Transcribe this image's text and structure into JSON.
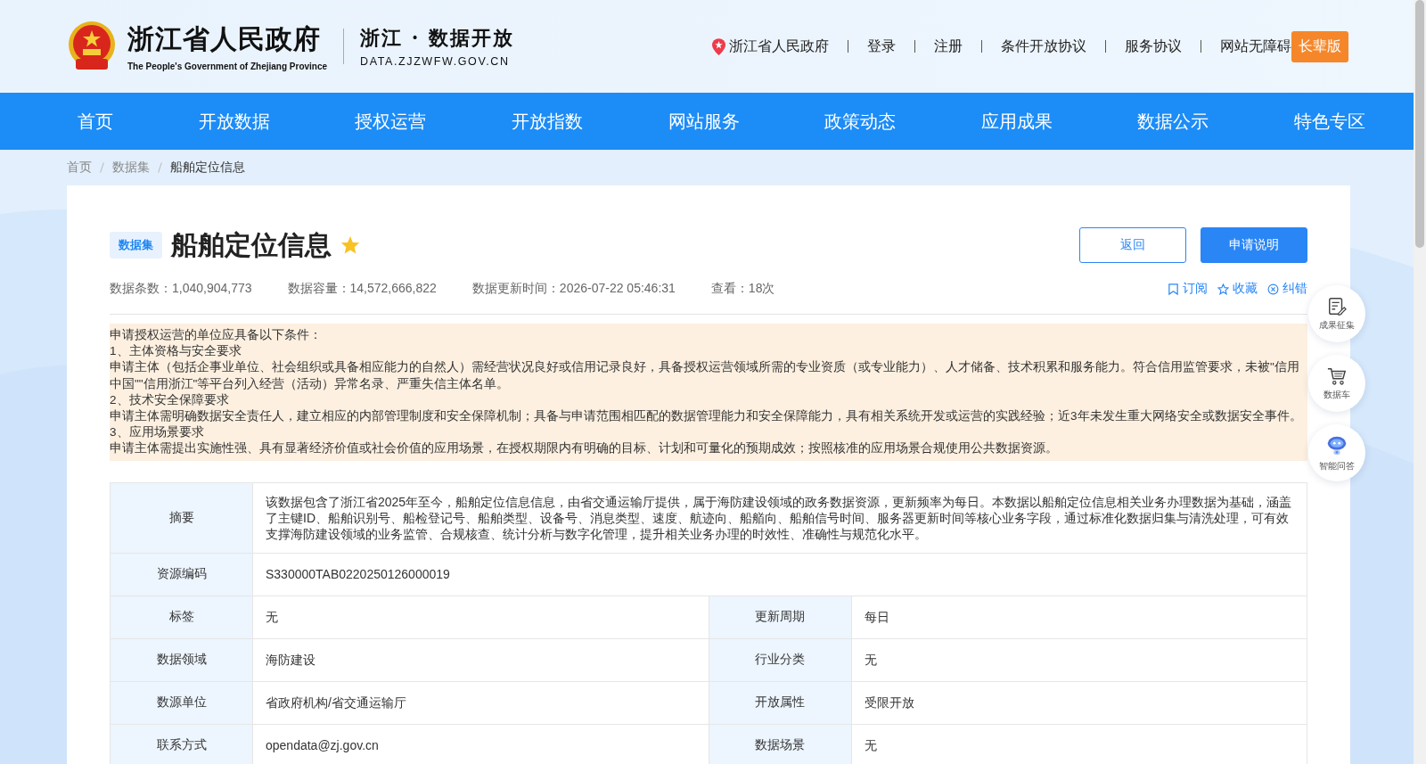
{
  "header": {
    "site_name": "浙江省人民政府",
    "site_name_en": "The People's Government of Zhejiang Province",
    "portal_name": "浙江 · 数据开放",
    "portal_url": "DATA.ZJZWFW.GOV.CN",
    "links": [
      "浙江省人民政府",
      "登录",
      "注册",
      "条件开放协议",
      "服务协议",
      "网站无障碍"
    ],
    "elder_button": "长辈版"
  },
  "nav": [
    "首页",
    "开放数据",
    "授权运营",
    "开放指数",
    "网站服务",
    "政策动态",
    "应用成果",
    "数据公示",
    "特色专区"
  ],
  "breadcrumb": [
    "首页",
    "数据集",
    "船舶定位信息"
  ],
  "dataset": {
    "tag": "数据集",
    "title": "船舶定位信息",
    "starred": true,
    "buttons": [
      {
        "label": "返回",
        "kind": "outline"
      },
      {
        "label": "申请说明",
        "kind": "primary"
      }
    ],
    "stats": [
      "数据条数：1,040,904,773",
      "数据容量：14,572,666,822",
      "数据更新时间：2026-07-22 05:46:31",
      "查看：18次"
    ],
    "actions": [
      {
        "label": "订阅",
        "kind": "subscribe"
      },
      {
        "label": "收藏",
        "kind": "favorite"
      },
      {
        "label": "纠错",
        "kind": "report"
      }
    ]
  },
  "notice": [
    "申请授权运营的单位应具备以下条件：",
    "1、主体资格与安全要求",
    "申请主体（包括企事业单位、社会组织或具备相应能力的自然人）需经营状况良好或信用记录良好，具备授权运营领域所需的专业资质（或专业能力）、人才储备、技术积累和服务能力。符合信用监管要求，未被\"信用中国\"\"信用浙江\"等平台列入经营（活动）异常名录、严重失信主体名单。",
    "2、技术安全保障要求",
    "申请主体需明确数据安全责任人，建立相应的内部管理制度和安全保障机制；具备与申请范围相匹配的数据管理能力和安全保障能力，具有相关系统开发或运营的实践经验；近3年未发生重大网络安全或数据安全事件。",
    "3、应用场景要求",
    "申请主体需提出实施性强、具有显著经济价值或社会价值的应用场景，在授权期限内有明确的目标、计划和可量化的预期成效；按照核准的应用场景合规使用公共数据资源。"
  ],
  "table": [
    {
      "cells": [
        {
          "label": "摘要",
          "value": "该数据包含了浙江省2025年至今，船舶定位信息信息，由省交通运输厅提供，属于海防建设领域的政务数据资源，更新频率为每日。本数据以船舶定位信息相关业务办理数据为基础，涵盖了主键ID、船舶识别号、船检登记号、船舶类型、设备号、消息类型、速度、航迹向、船艏向、船舶信号时间、服务器更新时间等核心业务字段，通过标准化数据归集与清洗处理，可有效支撑海防建设领域的业务监管、合规核查、统计分析与数字化管理，提升相关业务办理的时效性、准确性与规范化水平。"
        }
      ]
    },
    {
      "cells": [
        {
          "label": "资源编码",
          "value": "S330000TAB0220250126000019"
        }
      ]
    },
    {
      "cells": [
        {
          "label": "标签",
          "value": "无"
        },
        {
          "label": "更新周期",
          "value": "每日"
        }
      ]
    },
    {
      "cells": [
        {
          "label": "数据领域",
          "value": "海防建设"
        },
        {
          "label": "行业分类",
          "value": "无"
        }
      ]
    },
    {
      "cells": [
        {
          "label": "数源单位",
          "value": "省政府机构/省交通运输厅"
        },
        {
          "label": "开放属性",
          "value": "受限开放"
        }
      ]
    },
    {
      "cells": [
        {
          "label": "联系方式",
          "value": "opendata@zj.gov.cn"
        },
        {
          "label": "数据场景",
          "value": "无"
        }
      ]
    }
  ],
  "side_buttons": [
    {
      "label": "成果征集",
      "kind": "collect"
    },
    {
      "label": "数据车",
      "kind": "cart"
    },
    {
      "label": "智能问答",
      "kind": "robot"
    }
  ]
}
